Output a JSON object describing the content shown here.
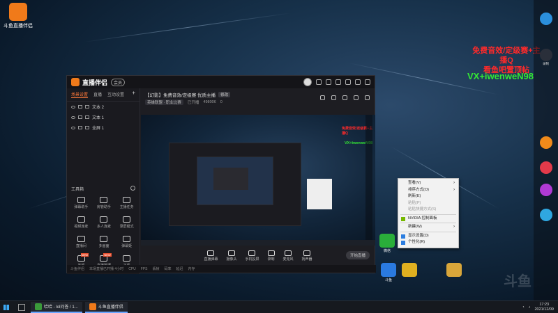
{
  "desktop": {
    "top_icon_label": "斗鱼直播伴侣",
    "overlay_red_line1": "免费音效/定级赛+主播Q",
    "overlay_red_line2": "看鱼吧置顶帖",
    "overlay_green": "VX+iwenweN98"
  },
  "app": {
    "title": "直播伴侣",
    "version_badge": "会员",
    "left_tabs": [
      "场景设置",
      "直播",
      "互动设置"
    ],
    "scenes": [
      "文本 2",
      "文本 1",
      "全屏 1"
    ],
    "tools_title": "工具箱",
    "tools": [
      {
        "label": "弹幕助手",
        "new": false
      },
      {
        "label": "房管助手",
        "new": false
      },
      {
        "label": "主播任务",
        "new": false
      },
      {
        "label": "视频连麦",
        "new": false
      },
      {
        "label": "多人连麦",
        "new": false
      },
      {
        "label": "录屏模式",
        "new": false
      },
      {
        "label": "直播间",
        "new": false
      },
      {
        "label": "多画面",
        "new": false
      },
      {
        "label": "弹幕姬",
        "new": false
      },
      {
        "label": "美颜",
        "new": true
      },
      {
        "label": "直播数据",
        "new": true
      },
      {
        "label": "下载",
        "new": false
      }
    ],
    "room_title": "【幻影】免费音效/定级赛 优质主播",
    "room_tag": "修改",
    "room_category": "英雄联盟 · 职业比赛",
    "room_status": "已开播 ",
    "room_viewers": "498006",
    "room_likes": "0",
    "controls": [
      "直播弹幕",
      "摄像头",
      "手机投屏",
      "录制",
      "麦克风",
      "扬声器"
    ],
    "start_button": "开始直播",
    "status_bar": [
      "斗鱼伴侣",
      "本场直播已开播 4小时",
      "CPU",
      "FPS",
      "丢帧",
      "码率",
      "延迟",
      "内存"
    ]
  },
  "context_menu": {
    "items": [
      {
        "label": "查看(V)",
        "disabled": false,
        "arrow": true
      },
      {
        "label": "排序方式(O)",
        "disabled": false,
        "arrow": true
      },
      {
        "label": "刷新(E)",
        "disabled": false,
        "arrow": false
      },
      {
        "label": "粘贴(P)",
        "disabled": true,
        "arrow": false
      },
      {
        "label": "粘贴快捷方式(S)",
        "disabled": true,
        "arrow": false
      },
      {
        "sep": true
      },
      {
        "label": "NVIDIA 控制面板",
        "disabled": false,
        "arrow": false,
        "icon": "nvidia-icon"
      },
      {
        "sep": true
      },
      {
        "label": "新建(W)",
        "disabled": false,
        "arrow": true
      },
      {
        "sep": true
      },
      {
        "label": "显示设置(D)",
        "disabled": false,
        "arrow": false,
        "icon": "display-icon"
      },
      {
        "label": "个性化(R)",
        "disabled": false,
        "arrow": false,
        "icon": "personalize-icon"
      }
    ]
  },
  "dock": [
    {
      "label": "",
      "color": "#2b8fdc"
    },
    {
      "label": "录制",
      "color": "#2a2f3a"
    },
    {
      "label": "",
      "color": "#f08a1a"
    },
    {
      "label": "",
      "color": "#e33a4a"
    },
    {
      "label": "",
      "color": "#b03ad4"
    },
    {
      "label": "",
      "color": "#2fa7e0"
    }
  ],
  "bottom_shortcuts": [
    {
      "label": "微信",
      "color": "#2aae3a"
    },
    {
      "label": "斗鱼",
      "color": "#2a7ae0"
    },
    {
      "label": "",
      "color": "#e0b020"
    },
    {
      "label": "",
      "color": "#d9a63a"
    }
  ],
  "taskbar": {
    "tasks": [
      {
        "label": "哈哈 - lol问答 / 1...",
        "color": "#3a9a3a"
      },
      {
        "label": "斗鱼直播伴侣",
        "color": "#f07a1a"
      }
    ],
    "time": "17:23",
    "date": "2021/12/09"
  },
  "watermark": "斗鱼"
}
